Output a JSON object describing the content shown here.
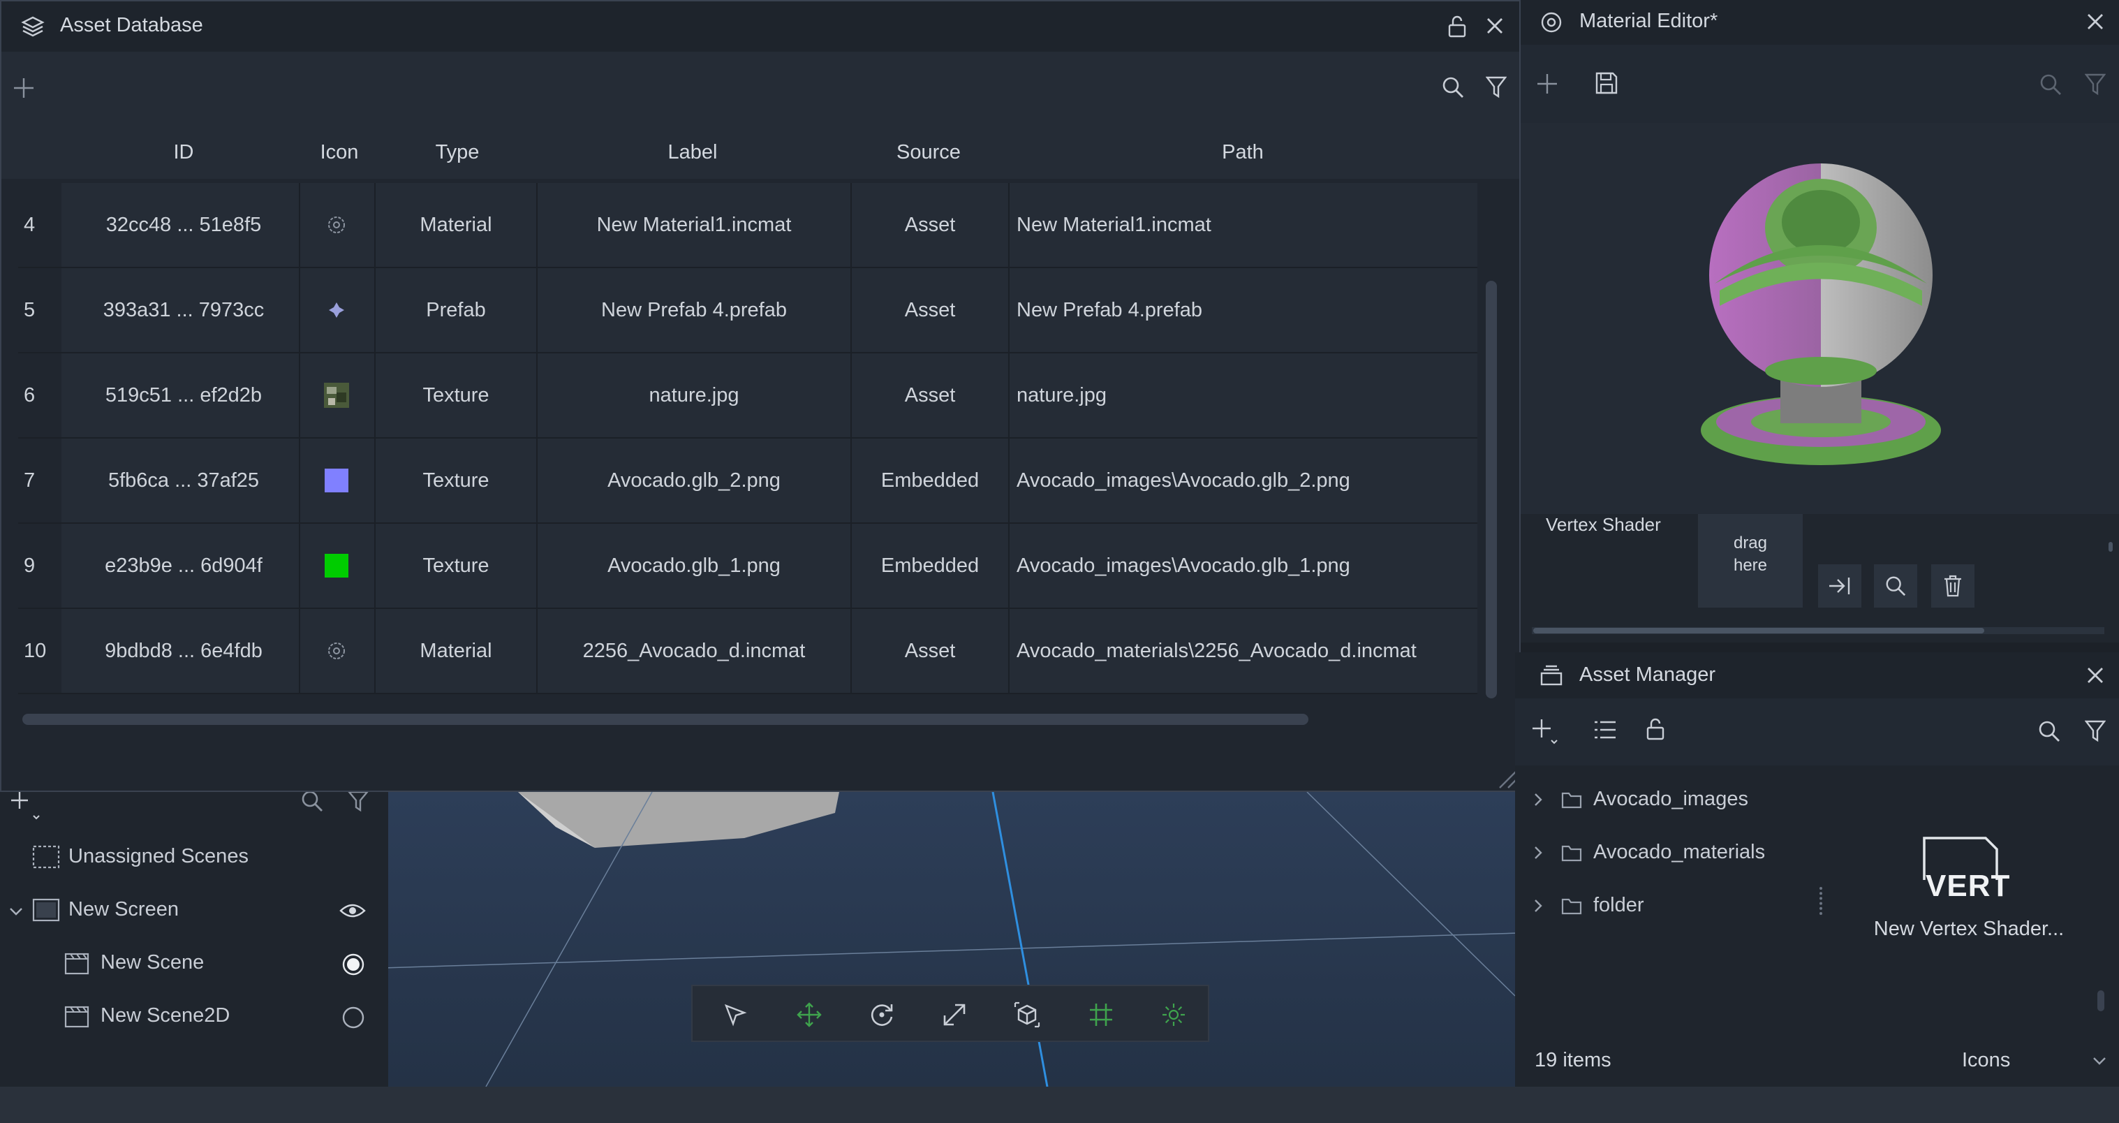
{
  "asset_db": {
    "title": "Asset Database",
    "columns": [
      "ID",
      "Icon",
      "Type",
      "Label",
      "Source",
      "Path"
    ],
    "rows": [
      {
        "index": "4",
        "id": "32cc48 ... 51e8f5",
        "icon": "material-icon",
        "type": "Material",
        "label": "New Material1.incmat",
        "source": "Asset",
        "path": "New Material1.incmat"
      },
      {
        "index": "5",
        "id": "393a31 ... 7973cc",
        "icon": "prefab-icon",
        "type": "Prefab",
        "label": "New Prefab 4.prefab",
        "source": "Asset",
        "path": "New Prefab 4.prefab"
      },
      {
        "index": "6",
        "id": "519c51 ... ef2d2b",
        "icon": "image-thumbnail",
        "type": "Texture",
        "label": "nature.jpg",
        "source": "Asset",
        "path": "nature.jpg"
      },
      {
        "index": "7",
        "id": "5fb6ca ... 37af25",
        "icon": "color-swatch",
        "swatch": "#8080ff",
        "type": "Texture",
        "label": "Avocado.glb_2.png",
        "source": "Embedded",
        "path": "Avocado_images\\Avocado.glb_2.png"
      },
      {
        "index": "9",
        "id": "e23b9e ... 6d904f",
        "icon": "color-swatch",
        "swatch": "#00cc00",
        "type": "Texture",
        "label": "Avocado.glb_1.png",
        "source": "Embedded",
        "path": "Avocado_images\\Avocado.glb_1.png"
      },
      {
        "index": "10",
        "id": "9bdbd8 ... 6e4fdb",
        "icon": "material-icon",
        "type": "Material",
        "label": "2256_Avocado_d.incmat",
        "source": "Asset",
        "path": "Avocado_materials\\2256_Avocado_d.incmat"
      }
    ]
  },
  "material_editor": {
    "title": "Material Editor*",
    "vertex_shader_label": "Vertex Shader",
    "drop_hint": "drag\nhere"
  },
  "asset_manager": {
    "title": "Asset Manager",
    "folders": [
      "Avocado_images",
      "Avocado_materials",
      "folder"
    ],
    "selected_asset": {
      "badge": "VERT",
      "name": "New Vertex Shader..."
    },
    "item_count": "19 items",
    "view_mode": "Icons"
  },
  "hierarchy": {
    "items": [
      {
        "label": "Unassigned Scenes",
        "level": 0
      },
      {
        "label": "New Screen",
        "level": 0
      },
      {
        "label": "New Scene",
        "level": 1
      },
      {
        "label": "New Scene2D",
        "level": 1
      }
    ]
  },
  "colors": {
    "accent_blue": "#2f8fe0",
    "gizmo_green": "#3fa34d",
    "swatch_blue": "#8080ff",
    "swatch_green": "#00cc00"
  }
}
